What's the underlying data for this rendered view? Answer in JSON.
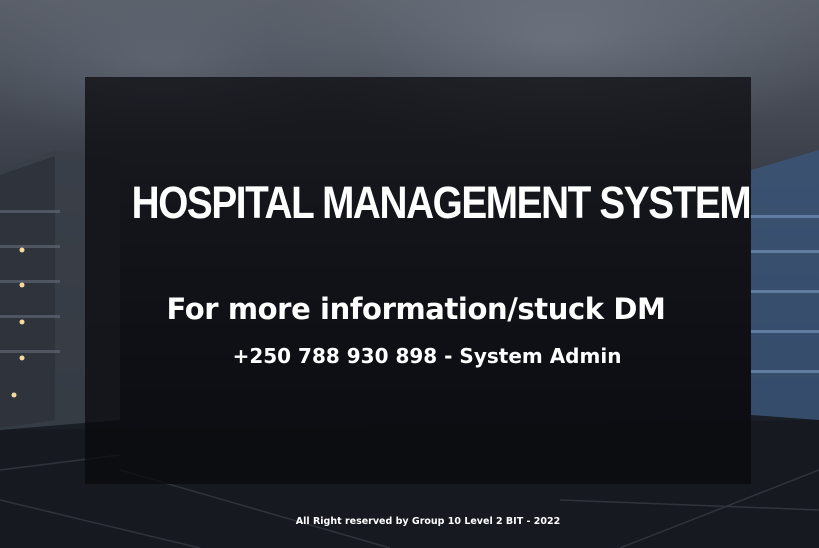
{
  "hero": {
    "title": "HOSPITAL MANAGEMENT SYSTEM",
    "info_line": "For more information/stuck DM",
    "contact_line": "+250 788 930 898 - System Admin"
  },
  "footer": {
    "copyright": "All Right reserved by Group 10 Level 2 BIT - 2022"
  },
  "colors": {
    "text": "#ffffff",
    "overlay": "#08090c",
    "background_dark": "#14171d"
  }
}
